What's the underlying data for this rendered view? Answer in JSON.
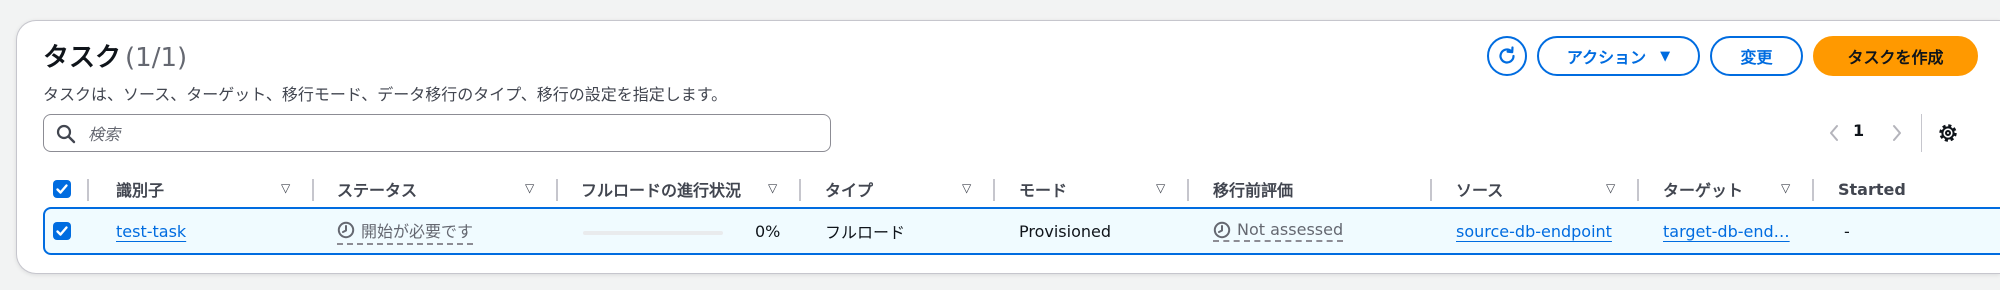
{
  "header": {
    "title": "タスク",
    "count": "(1/1)",
    "description": "タスクは、ソース、ターゲット、移行モード、データ移行のタイプ、移行の設定を指定します。"
  },
  "toolbar": {
    "actions_label": "アクション",
    "edit_label": "変更",
    "create_label": "タスクを作成"
  },
  "search": {
    "placeholder": "検索",
    "value": ""
  },
  "pagination": {
    "current_page": "1"
  },
  "colors": {
    "accent": "#006ce0",
    "primary_button": "#ff9900",
    "selected_row_bg": "#f0fbff"
  },
  "table": {
    "columns": [
      "識別子",
      "ステータス",
      "フルロードの進行状況",
      "タイプ",
      "モード",
      "移行前評価",
      "ソース",
      "ターゲット",
      "Started"
    ],
    "rows": [
      {
        "selected": true,
        "identifier": "test-task",
        "status": "開始が必要です",
        "progress_percent": 0,
        "progress_label": "0%",
        "type": "フルロード",
        "mode": "Provisioned",
        "premigration": "Not assessed",
        "source": "source-db-endpoint",
        "target": "target-db-end…",
        "started": "-"
      }
    ]
  }
}
